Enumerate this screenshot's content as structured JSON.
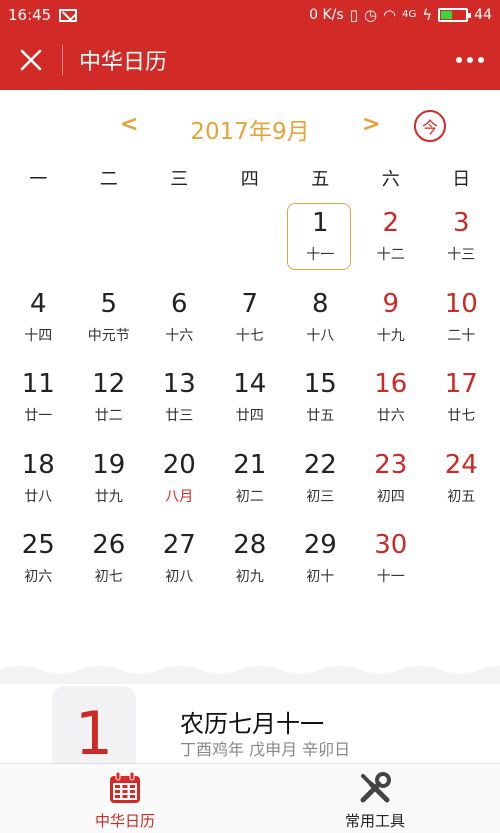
{
  "status_bar": {
    "time": "16:45",
    "speed": "0 K/s",
    "battery": "44",
    "battery_level": 0.44,
    "network": "4G"
  },
  "title_bar": {
    "title": "中华日历"
  },
  "calendar": {
    "month_title": "2017年9月",
    "prev_label": "<",
    "next_label": ">",
    "today_label": "今",
    "weekdays": [
      "一",
      "二",
      "三",
      "四",
      "五",
      "六",
      "日"
    ],
    "days": [
      {
        "num": "",
        "lunar": ""
      },
      {
        "num": "",
        "lunar": ""
      },
      {
        "num": "",
        "lunar": ""
      },
      {
        "num": "",
        "lunar": ""
      },
      {
        "num": "1",
        "lunar": "十一",
        "selected": true
      },
      {
        "num": "2",
        "lunar": "十二",
        "weekend": true
      },
      {
        "num": "3",
        "lunar": "十三",
        "weekend": true
      },
      {
        "num": "4",
        "lunar": "十四"
      },
      {
        "num": "5",
        "lunar": "中元节"
      },
      {
        "num": "6",
        "lunar": "十六"
      },
      {
        "num": "7",
        "lunar": "十七"
      },
      {
        "num": "8",
        "lunar": "十八"
      },
      {
        "num": "9",
        "lunar": "十九",
        "weekend": true
      },
      {
        "num": "10",
        "lunar": "二十",
        "weekend": true
      },
      {
        "num": "11",
        "lunar": "廿一"
      },
      {
        "num": "12",
        "lunar": "廿二"
      },
      {
        "num": "13",
        "lunar": "廿三"
      },
      {
        "num": "14",
        "lunar": "廿四"
      },
      {
        "num": "15",
        "lunar": "廿五"
      },
      {
        "num": "16",
        "lunar": "廿六",
        "weekend": true
      },
      {
        "num": "17",
        "lunar": "廿七",
        "weekend": true
      },
      {
        "num": "18",
        "lunar": "廿八"
      },
      {
        "num": "19",
        "lunar": "廿九"
      },
      {
        "num": "20",
        "lunar": "八月",
        "festival": true
      },
      {
        "num": "21",
        "lunar": "初二"
      },
      {
        "num": "22",
        "lunar": "初三"
      },
      {
        "num": "23",
        "lunar": "初四",
        "weekend": true
      },
      {
        "num": "24",
        "lunar": "初五",
        "weekend": true
      },
      {
        "num": "25",
        "lunar": "初六"
      },
      {
        "num": "26",
        "lunar": "初七"
      },
      {
        "num": "27",
        "lunar": "初八"
      },
      {
        "num": "28",
        "lunar": "初九"
      },
      {
        "num": "29",
        "lunar": "初十"
      },
      {
        "num": "30",
        "lunar": "十一",
        "weekend": true
      }
    ]
  },
  "detail": {
    "day": "1",
    "lunar_title": "农历七月十一",
    "ganzhi": "丁酉鸡年 戊申月 辛卯日"
  },
  "bottom_nav": {
    "items": [
      {
        "label": "中华日历",
        "icon": "calendar-icon",
        "active": true
      },
      {
        "label": "常用工具",
        "icon": "tools-icon",
        "active": false
      }
    ]
  },
  "colors": {
    "brand_red": "#d22a26",
    "accent_gold": "#e6a33a"
  }
}
